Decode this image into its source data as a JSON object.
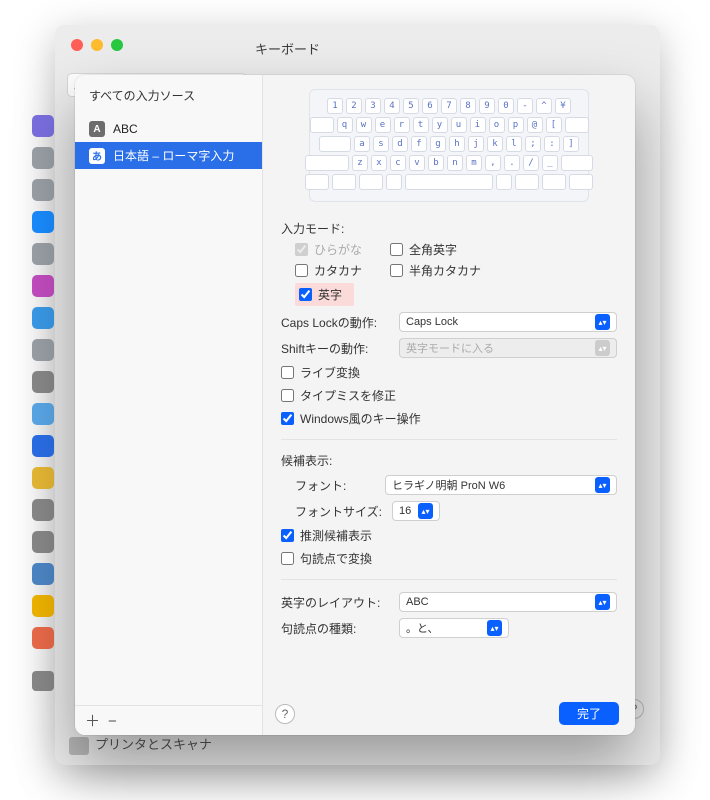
{
  "window": {
    "title": "キーボード"
  },
  "bg_footer": "プリンタとスキャナ",
  "strip_colors": [
    "#7b6fe0",
    "#9aa0a6",
    "#9aa0a6",
    "#198cff",
    "#9aa0a6",
    "#c34cc0",
    "#3a9ae8",
    "#9aa0a6",
    "#888",
    "#5aa7e8",
    "#2a6fe8",
    "#e6b834",
    "#888",
    "#888",
    "#4d86c6",
    "#f0b400",
    "#eb6a4a"
  ],
  "sheet": {
    "header": "すべての入力ソース",
    "sources": [
      {
        "badge": "A",
        "label": "ABC",
        "selected": false
      },
      {
        "badge": "あ",
        "label": "日本語 – ローマ字入力",
        "selected": true
      }
    ],
    "add": "＋",
    "remove": "−",
    "keyboard_rows": [
      [
        "1",
        "2",
        "3",
        "4",
        "5",
        "6",
        "7",
        "8",
        "9",
        "0",
        "-",
        "^",
        "¥"
      ],
      [
        "q",
        "w",
        "e",
        "r",
        "t",
        "y",
        "u",
        "i",
        "o",
        "p",
        "@",
        "["
      ],
      [
        "a",
        "s",
        "d",
        "f",
        "g",
        "h",
        "j",
        "k",
        "l",
        ";",
        ":",
        "]"
      ],
      [
        "z",
        "x",
        "c",
        "v",
        "b",
        "n",
        "m",
        ",",
        ".",
        "/",
        "_"
      ]
    ],
    "input_mode_label": "入力モード:",
    "modes": {
      "hiragana": "ひらがな",
      "zenkaku": "全角英字",
      "katakana": "カタカナ",
      "hankata": "半角カタカナ",
      "eiji": "英字"
    },
    "capslock_label": "Caps Lockの動作:",
    "capslock_value": "Caps Lock",
    "shift_label": "Shiftキーの動作:",
    "shift_value": "英字モードに入る",
    "live": "ライブ変換",
    "typo": "タイプミスを修正",
    "windows": "Windows風のキー操作",
    "cand_label": "候補表示:",
    "font_label": "フォント:",
    "font_value": "ヒラギノ明朝 ProN W6",
    "fontsize_label": "フォントサイズ:",
    "fontsize_value": "16",
    "predict": "推測候補表示",
    "punct_conv": "句読点で変換",
    "eiji_layout_label": "英字のレイアウト:",
    "eiji_layout_value": "ABC",
    "punct_type_label": "句読点の種類:",
    "punct_type_value": "。と、",
    "done": "完了"
  }
}
